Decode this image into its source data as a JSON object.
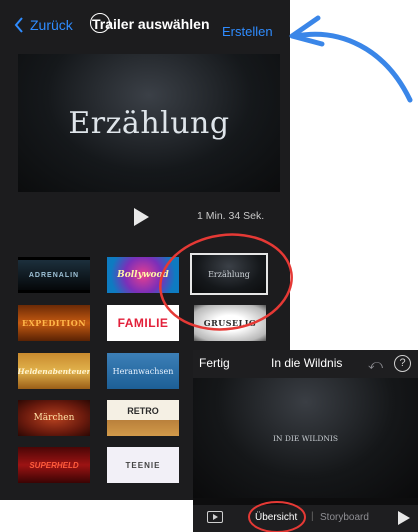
{
  "nav": {
    "back_label": "Zurück",
    "title": "Trailer auswählen",
    "create_label": "Erstellen"
  },
  "preview": {
    "title": "Erzählung",
    "duration": "1 Min. 34 Sek."
  },
  "trailers": [
    {
      "label": "ADRENALIN"
    },
    {
      "label": "Bollywood"
    },
    {
      "label": "Erzählung",
      "selected": true
    },
    {
      "label": "EXPEDITION"
    },
    {
      "label": "FAMILIE"
    },
    {
      "label": "GRUSELIG"
    },
    {
      "label": "Heldenabenteuer"
    },
    {
      "label": "Heranwachsen"
    },
    {
      "label": "Märchen"
    },
    {
      "label": "RETRO"
    },
    {
      "label": "SUPERHELD"
    },
    {
      "label": "TEENIE"
    }
  ],
  "detail": {
    "done_label": "Fertig",
    "title": "In die Wildnis",
    "video_text": "IN DIE WILDNIS",
    "tab_overview": "Übersicht",
    "tab_separator": "|",
    "tab_storyboard": "Storyboard"
  },
  "colors": {
    "accent": "#2f8cff",
    "annotation": "#e53935",
    "arrow": "#3a86e8",
    "background": "#1c1c1e"
  }
}
